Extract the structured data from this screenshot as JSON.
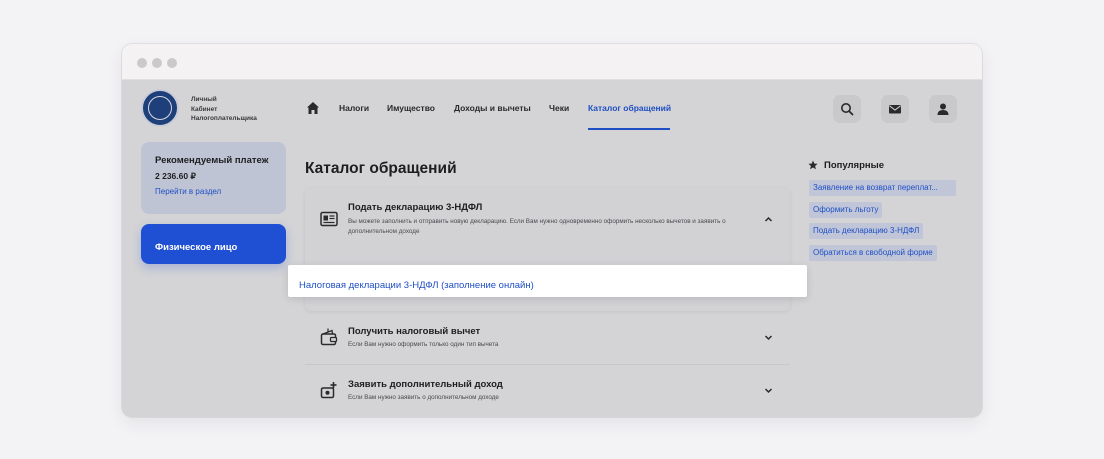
{
  "logo": {
    "line1": "Личный",
    "line2": "Кабинет",
    "line3": "Налогоплательщика"
  },
  "nav": {
    "items": [
      {
        "label": "Налоги"
      },
      {
        "label": "Имущество"
      },
      {
        "label": "Доходы и вычеты"
      },
      {
        "label": "Чеки"
      },
      {
        "label": "Каталог обращений"
      }
    ],
    "active_index": 4
  },
  "header_icons": [
    "search-icon",
    "mail-icon",
    "user-icon"
  ],
  "sidebar": {
    "payment": {
      "title": "Рекомендуемый платеж",
      "amount": "2 236.60 ₽",
      "link": "Перейти в раздел"
    },
    "person": {
      "label": "Физическое лицо"
    }
  },
  "main": {
    "title": "Каталог обращений",
    "items": [
      {
        "title": "Подать декларацию 3-НДФЛ",
        "desc": "Вы можете заполнить и отправить новую декларацию. Если Вам нужно одновременно оформить несколько вычетов и заявить о дополнительном доходе",
        "icon": "declaration-icon",
        "expanded": true
      },
      {
        "title": "Получить налоговый вычет",
        "desc": "Если Вам нужно оформить только один тип вычета",
        "icon": "wallet-icon",
        "expanded": false
      },
      {
        "title": "Заявить дополнительный доход",
        "desc": "Если Вам нужно заявить о дополнительном доходе",
        "icon": "income-icon",
        "expanded": false
      }
    ],
    "dropdown_option": "Налоговая декларации 3-НДФЛ (заполнение онлайн)"
  },
  "popular": {
    "title": "Популярные",
    "links": [
      "Заявление на возврат переплат...",
      "Оформить льготу",
      "Подать декларацию 3-НДФЛ",
      "Обратиться в свободной форме"
    ]
  },
  "colors": {
    "accent": "#1f4fc4",
    "primary_button": "#1f4fd2",
    "overlay": "#d4d4d6"
  }
}
